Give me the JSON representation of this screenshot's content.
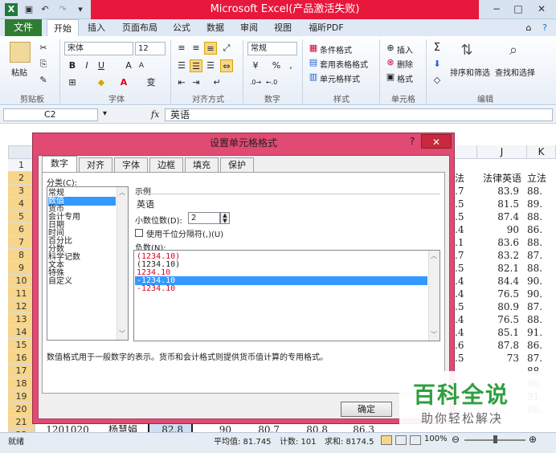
{
  "window": {
    "title": "Microsoft Excel(产品激活失败)",
    "controls": {
      "minimize": "−",
      "restore": "□",
      "close": "✕"
    }
  },
  "ribbon": {
    "file_tab": "文件",
    "tabs": [
      "开始",
      "插入",
      "页面布局",
      "公式",
      "数据",
      "审阅",
      "视图",
      "福昕PDF"
    ],
    "clipboard": {
      "paste": "粘贴",
      "label": "剪贴板"
    },
    "font": {
      "name": "宋体",
      "size": "12",
      "bold": "B",
      "italic": "I",
      "underline": "U",
      "grow": "A",
      "shrink": "A",
      "font_color": "A",
      "phonetic": "变",
      "label": "字体"
    },
    "alignment": {
      "label": "对齐方式"
    },
    "number": {
      "format": "常规",
      "percent": "%",
      "comma": ",",
      "label": "数字"
    },
    "styles": {
      "conditional": "条件格式",
      "table": "套用表格格式",
      "cell": "单元格样式",
      "label": "样式"
    },
    "cells": {
      "insert": "插入",
      "delete": "删除",
      "format": "格式",
      "label": "单元格"
    },
    "editing": {
      "sigma": "Σ",
      "sort": "排序和筛选",
      "find": "查找和选择",
      "label": "编辑"
    }
  },
  "formula_bar": {
    "name_box": "C2",
    "fx": "fx",
    "content": "英语"
  },
  "sheet": {
    "col_j": "J",
    "col_k": "K",
    "header_j": "法律英语",
    "header_i_partial": "法",
    "header_k_partial": "立法",
    "rows": [
      "1",
      "2",
      "3",
      "4",
      "5",
      "6",
      "7",
      "8",
      "9",
      "10",
      "11",
      "12",
      "13",
      "14",
      "15",
      "16",
      "17",
      "18",
      "19",
      "20",
      "21",
      "22"
    ],
    "col_i_vals": [
      ".7",
      ".5",
      ".5",
      ".4",
      ".1",
      ".7",
      ".5",
      ".4",
      ".4",
      ".5",
      ".4",
      ".4",
      ".6",
      ".5"
    ],
    "col_j_vals": [
      "83.9",
      "81.5",
      "87.4",
      "90",
      "83.6",
      "83.2",
      "82.1",
      "84.4",
      "76.5",
      "80.9",
      "76.5",
      "85.1",
      "87.8",
      "73"
    ],
    "col_k_vals": [
      "88.",
      "89.",
      "88.",
      "86.",
      "88.",
      "87.",
      "88.",
      "90.",
      "90.",
      "87.",
      "88.",
      "91.",
      "86.",
      "87."
    ],
    "row22": [
      "1201020",
      "杨慧娟",
      "82.8",
      "90",
      "80.7",
      "80.8",
      "86.3"
    ],
    "col_k_tail": [
      "88.",
      "90.",
      "91.",
      "86."
    ]
  },
  "dialog": {
    "title": "设置单元格格式",
    "help": "?",
    "close": "✕",
    "tabs": [
      "数字",
      "对齐",
      "字体",
      "边框",
      "填充",
      "保护"
    ],
    "category_label": "分类(C):",
    "categories": [
      "常规",
      "数值",
      "货币",
      "会计专用",
      "日期",
      "时间",
      "百分比",
      "分数",
      "科学记数",
      "文本",
      "特殊",
      "自定义"
    ],
    "selected_category": "数值",
    "sample_label": "示例",
    "sample_value": "英语",
    "decimals_label": "小数位数(D):",
    "decimals_value": "2",
    "thousands_label": "使用千位分隔符(,)(U)",
    "negative_label": "负数(N):",
    "negatives": [
      "(1234.10)",
      "(1234.10)",
      "1234.10",
      "-1234.10",
      "-1234.10"
    ],
    "description": "数值格式用于一般数字的表示。货币和会计格式则提供货币值计算的专用格式。",
    "ok": "确定",
    "colors": {
      "red": "#e0001b",
      "selection": "#3399ff",
      "frame": "#e04a73"
    }
  },
  "status": {
    "mode": "就绪",
    "average": "平均值: 81.745",
    "count": "计数: 101",
    "sum": "求和: 8174.5",
    "zoom": "100%"
  },
  "watermark": {
    "title": "百科全说",
    "subtitle": "助你轻松解决"
  }
}
